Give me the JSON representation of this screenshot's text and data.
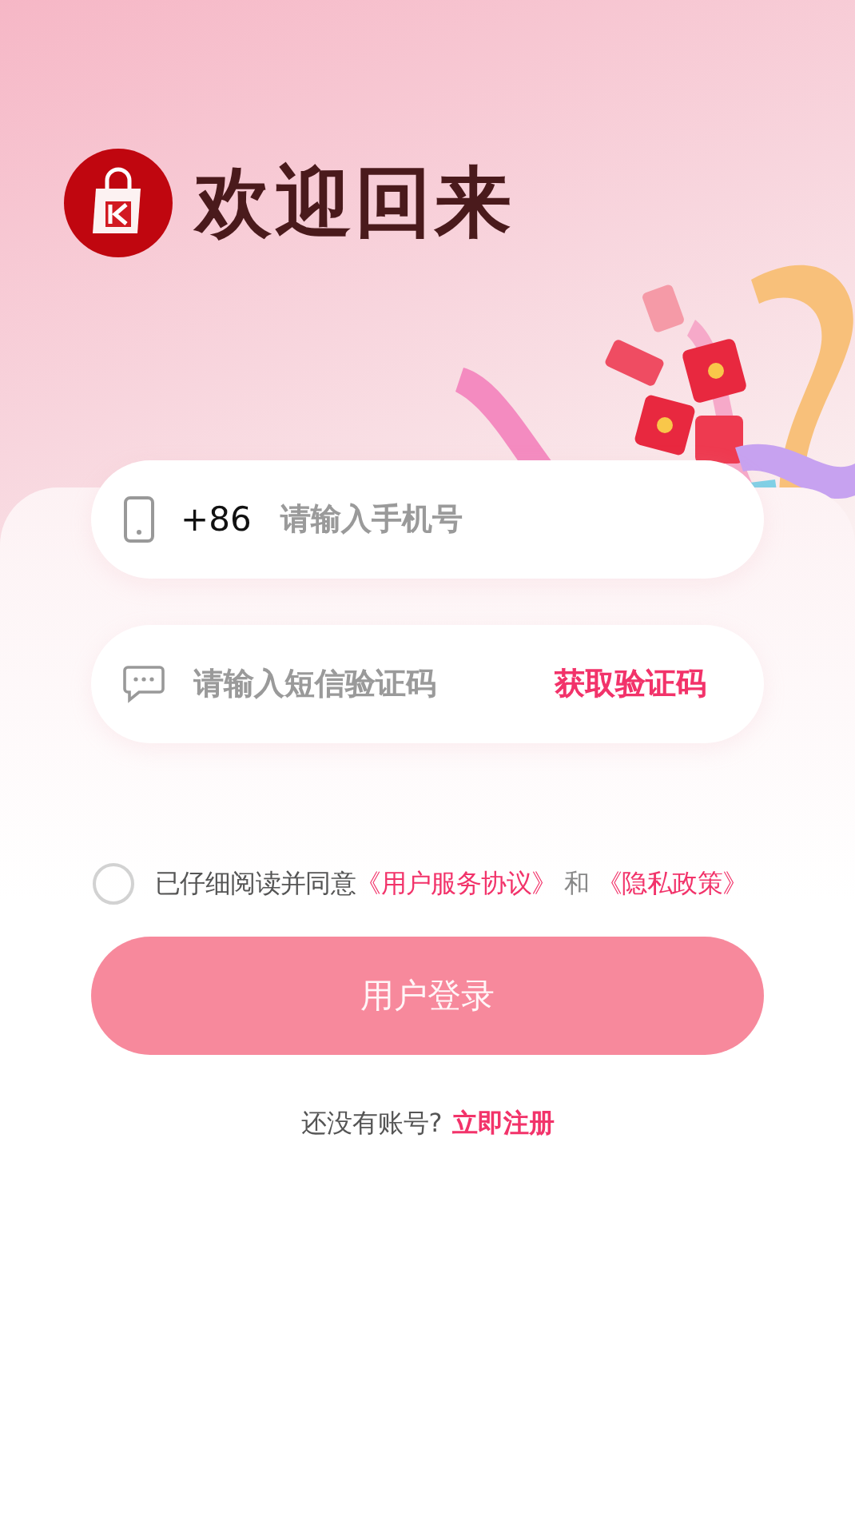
{
  "header": {
    "title": "欢迎回来"
  },
  "phone_field": {
    "country_code": "+86",
    "placeholder": "请输入手机号"
  },
  "code_field": {
    "placeholder": "请输入短信验证码",
    "action": "获取验证码"
  },
  "agreement": {
    "checked": false,
    "parts": [
      {
        "kind": "text",
        "text": "已仔细阅读并同意"
      },
      {
        "kind": "link",
        "text": "《用户服务协议》"
      },
      {
        "kind": "text",
        "text": " 和 "
      },
      {
        "kind": "link",
        "text": "《隐私政策》"
      }
    ]
  },
  "login_button": {
    "label": "用户登录",
    "disabled": true
  },
  "register": {
    "prompt": "还没有账号?",
    "link": "立即注册"
  }
}
